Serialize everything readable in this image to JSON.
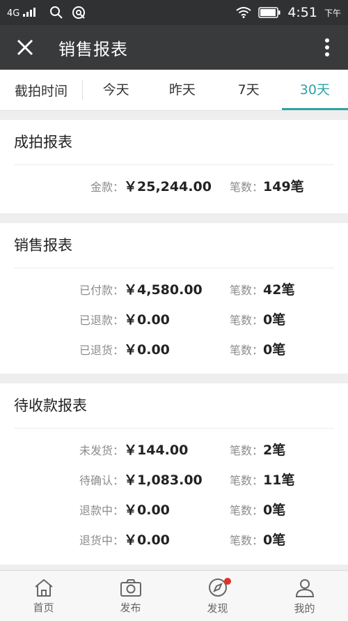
{
  "status_bar": {
    "network": "4G",
    "time": "4:51",
    "ampm": "下午"
  },
  "header": {
    "title": "销售报表"
  },
  "tabs": {
    "label": "截拍时间",
    "items": [
      {
        "label": "今天"
      },
      {
        "label": "昨天"
      },
      {
        "label": "7天"
      },
      {
        "label": "30天"
      }
    ],
    "active": "30天"
  },
  "sections": [
    {
      "title": "成拍报表",
      "rows": [
        {
          "label": "金款：",
          "amount": "￥25,244.00",
          "count_label": "笔数：",
          "count": "149笔"
        }
      ]
    },
    {
      "title": "销售报表",
      "rows": [
        {
          "label": "已付款：",
          "amount": "￥4,580.00",
          "count_label": "笔数：",
          "count": "42笔"
        },
        {
          "label": "已退款：",
          "amount": "￥0.00",
          "count_label": "笔数：",
          "count": "0笔"
        },
        {
          "label": "已退货：",
          "amount": "￥0.00",
          "count_label": "笔数：",
          "count": "0笔"
        }
      ]
    },
    {
      "title": "待收款报表",
      "rows": [
        {
          "label": "未发货：",
          "amount": "￥144.00",
          "count_label": "笔数：",
          "count": "2笔"
        },
        {
          "label": "待确认：",
          "amount": "￥1,083.00",
          "count_label": "笔数：",
          "count": "11笔"
        },
        {
          "label": "退款中：",
          "amount": "￥0.00",
          "count_label": "笔数：",
          "count": "0笔"
        },
        {
          "label": "退货中：",
          "amount": "￥0.00",
          "count_label": "笔数：",
          "count": "0笔"
        }
      ]
    }
  ],
  "bottom_nav": [
    {
      "label": "首页",
      "icon": "home-icon"
    },
    {
      "label": "发布",
      "icon": "camera-icon"
    },
    {
      "label": "发现",
      "icon": "compass-icon"
    },
    {
      "label": "我的",
      "icon": "user-icon"
    }
  ],
  "colors": {
    "accent": "#2fa3a3",
    "header_bg": "#393a3c",
    "status_bg": "#2f3133",
    "badge": "#e0332a"
  }
}
